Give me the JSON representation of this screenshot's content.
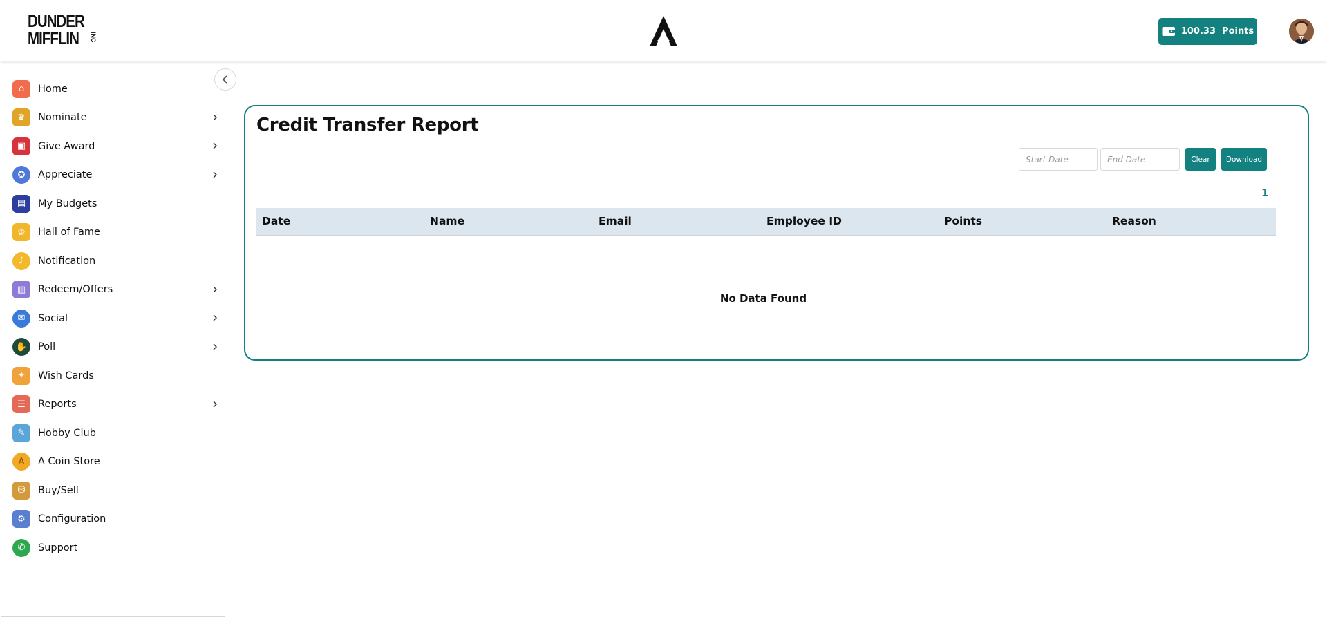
{
  "header": {
    "logo_line1": "DUNDER",
    "logo_line2": "MIFFLIN",
    "logo_suffix": "INC",
    "points_label": "100.33  Points",
    "points_icon": "wallet-icon",
    "brand_icon": "a-logo-icon"
  },
  "colors": {
    "accent": "#13817f",
    "table_header_bg": "#dbe6ef",
    "card_border": "#15817f"
  },
  "sidebar": {
    "items": [
      {
        "label": "Home",
        "icon": "home-icon",
        "has_submenu": false
      },
      {
        "label": "Nominate",
        "icon": "trophy-icon",
        "has_submenu": true
      },
      {
        "label": "Give Award",
        "icon": "gift-icon",
        "has_submenu": true
      },
      {
        "label": "Appreciate",
        "icon": "medal-icon",
        "has_submenu": true
      },
      {
        "label": "My Budgets",
        "icon": "wallet-icon",
        "has_submenu": false
      },
      {
        "label": "Hall of Fame",
        "icon": "crown-icon",
        "has_submenu": false
      },
      {
        "label": "Notification",
        "icon": "bell-icon",
        "has_submenu": false
      },
      {
        "label": "Redeem/Offers",
        "icon": "offers-icon",
        "has_submenu": true
      },
      {
        "label": "Social",
        "icon": "chat-icon",
        "has_submenu": true
      },
      {
        "label": "Poll",
        "icon": "poll-icon",
        "has_submenu": true
      },
      {
        "label": "Wish Cards",
        "icon": "party-popper-icon",
        "has_submenu": false
      },
      {
        "label": "Reports",
        "icon": "clipboard-icon",
        "has_submenu": true
      },
      {
        "label": "Hobby Club",
        "icon": "palette-icon",
        "has_submenu": false
      },
      {
        "label": "A Coin Store",
        "icon": "coin-icon",
        "has_submenu": false
      },
      {
        "label": "Buy/Sell",
        "icon": "shopping-bags-icon",
        "has_submenu": false
      },
      {
        "label": "Configuration",
        "icon": "monitor-settings-icon",
        "has_submenu": false
      },
      {
        "label": "Support",
        "icon": "phone-icon",
        "has_submenu": false
      }
    ]
  },
  "report": {
    "title": "Credit Transfer Report",
    "start_date_placeholder": "Start Date",
    "end_date_placeholder": "End Date",
    "clear_label": "Clear",
    "download_label": "Download",
    "page_number": "1",
    "columns": [
      "Date",
      "Name",
      "Email",
      "Employee ID",
      "Points",
      "Reason"
    ],
    "empty_message": "No Data Found"
  }
}
